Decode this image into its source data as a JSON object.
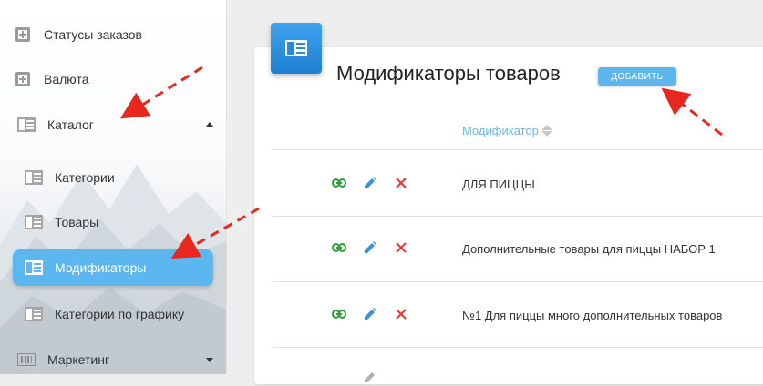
{
  "sidebar": {
    "items": [
      {
        "label": "Статусы заказов",
        "icon": "plus-square-icon"
      },
      {
        "label": "Валюта",
        "icon": "plus-square-icon"
      },
      {
        "label": "Каталог",
        "icon": "list-panel-icon"
      },
      {
        "label": "Категории",
        "icon": "list-panel-icon"
      },
      {
        "label": "Товары",
        "icon": "list-panel-icon"
      },
      {
        "label": "Модификаторы",
        "icon": "list-panel-icon",
        "active": true
      },
      {
        "label": "Категории по графику",
        "icon": "list-panel-icon"
      },
      {
        "label": "Маркетинг",
        "icon": "barcode-icon"
      }
    ]
  },
  "main": {
    "title": "Модификаторы товаров",
    "add_label": "ДОБАВИТЬ",
    "column_header": "Модификатор",
    "rows": [
      {
        "name": "ДЛЯ ПИЦЦЫ"
      },
      {
        "name": "Дополнительные товары для пиццы НАБОР 1"
      },
      {
        "name": "№1 Для пиццы много дополнительных товаров"
      }
    ]
  },
  "colors": {
    "accent": "#5cb6f0",
    "link_icon": "#2e9e3a",
    "edit_icon": "#3d8fd6",
    "delete_icon": "#e53935",
    "annotation_arrow": "#e8271f"
  }
}
